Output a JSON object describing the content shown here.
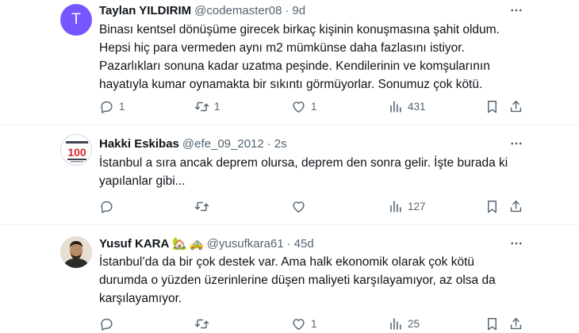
{
  "tweets": [
    {
      "avatar_letter": "T",
      "name": "Taylan YILDIRIM",
      "handle": "@codemaster08",
      "time": "9d",
      "lines": [
        "Binası kentsel dönüşüme girecek birkaç kişinin konuşmasına şahit oldum.",
        "Hepsi hiç para vermeden aynı m2 mümkünse daha fazlasını istiyor.",
        "Pazarlıkları sonuna kadar uzatma peşinde. Kendilerinin ve komşularının",
        "hayatıyla kumar oynamakta bir sıkıntı görmüyorlar. Sonumuz çok kötü."
      ],
      "replies": "1",
      "retweets": "1",
      "likes": "1",
      "views": "431"
    },
    {
      "avatar_text": "100",
      "name": "Hakki Eskibas",
      "handle": "@efe_09_2012",
      "time": "2s",
      "lines": [
        "İstanbul a sıra ancak deprem olursa, deprem den sonra gelir. İşte burada ki",
        "yapılanlar gibi..."
      ],
      "replies": "",
      "retweets": "",
      "likes": "",
      "views": "127"
    },
    {
      "name": "Yusuf KARA",
      "name_emoji": [
        "🏡",
        "🚕"
      ],
      "handle": "@yusufkara61",
      "time": "45d",
      "lines": [
        "İstanbul’da da bir çok destek var. Ama halk ekonomik olarak çok kötü",
        "durumda o yüzden üzerinlerine düşen maliyeti karşılayamıyor, az olsa da",
        "karşılayamıyor."
      ],
      "replies": "",
      "retweets": "",
      "likes": "1",
      "views": "25"
    }
  ],
  "separator": "·",
  "icons": {
    "more": "more-horizontal-icon",
    "reply": "reply-icon",
    "retweet": "retweet-icon",
    "like": "heart-icon",
    "views": "views-icon",
    "bookmark": "bookmark-icon",
    "share": "share-icon"
  },
  "colors": {
    "text": "#0f1419",
    "secondary": "#536471",
    "divider": "#eff3f4",
    "avatar_purple": "#7856ff"
  }
}
